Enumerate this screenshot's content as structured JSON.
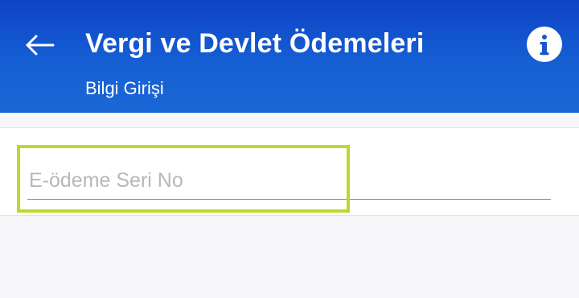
{
  "header": {
    "title": "Vergi ve Devlet Ödemeleri",
    "subtitle": "Bilgi Girişi",
    "back_icon": "arrow-left-icon",
    "info_icon": "info-icon"
  },
  "form": {
    "eodeme_serial_placeholder": "E-ödeme Seri No",
    "eodeme_serial_value": ""
  },
  "colors": {
    "header_gradient_start": "#0f43c6",
    "header_gradient_end": "#1a67d6",
    "focus_highlight": "#b8db2b",
    "background": "#f7f7f9"
  }
}
